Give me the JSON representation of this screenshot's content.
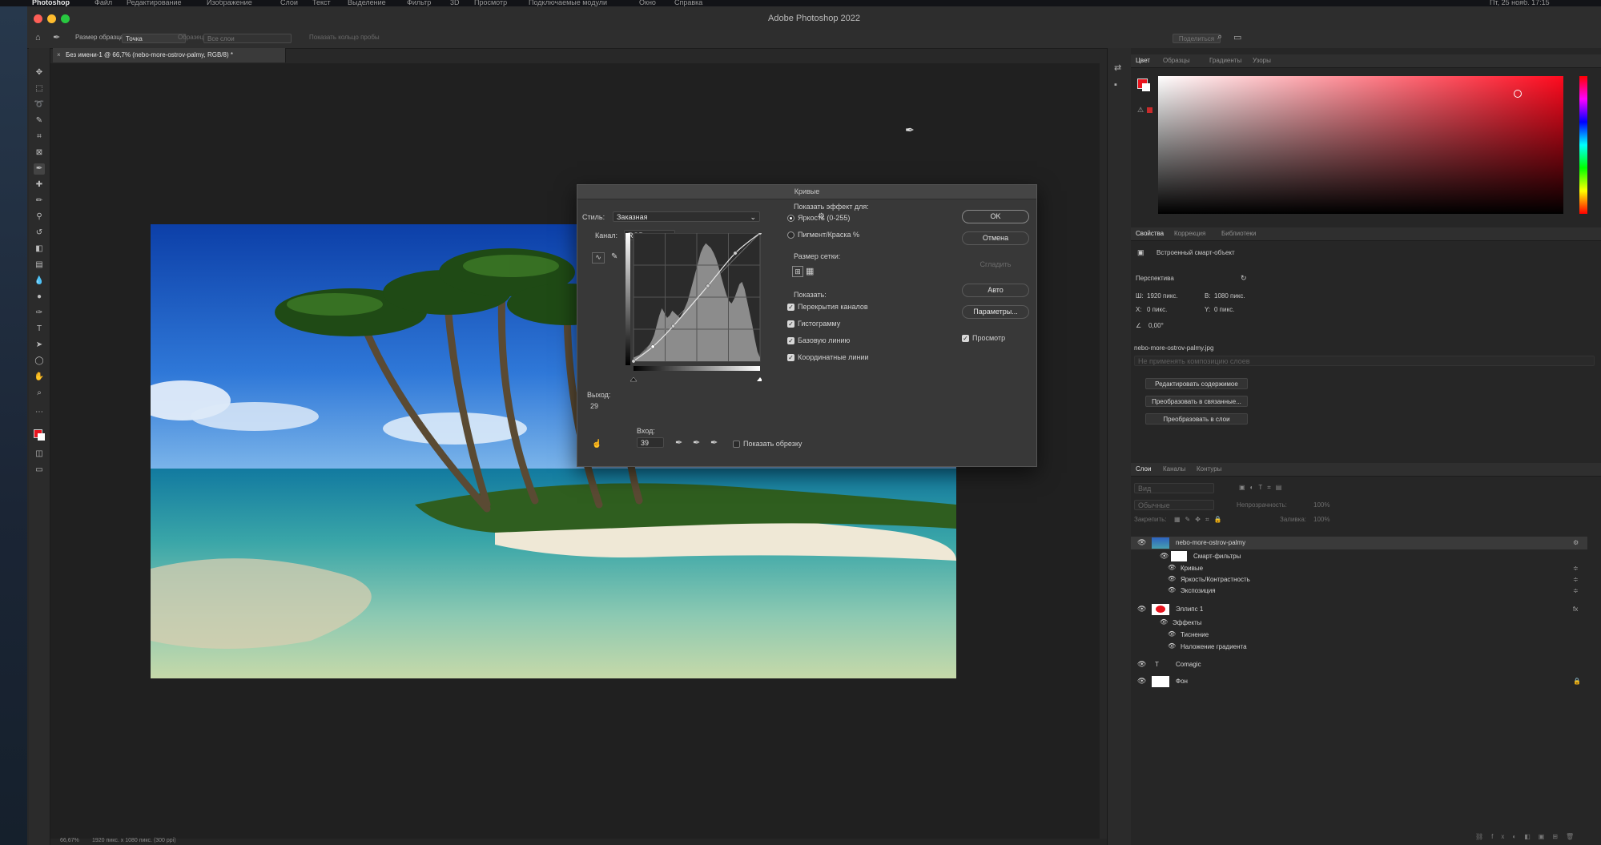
{
  "menu_bar": {
    "items": [
      "Photoshop",
      "Файл",
      "Редактирование",
      "Изображение",
      "Слои",
      "Текст",
      "Выделение",
      "Фильтр",
      "3D",
      "Просмотр",
      "Подключаемые модули",
      "Окно",
      "Справка"
    ],
    "clock": "Пт, 25 нояб. 17:15"
  },
  "window": {
    "title": "Adobe Photoshop 2022"
  },
  "options_bar": {
    "sample_size_label": "Размер образца:",
    "sample_size_value": "Точка",
    "sample_label": "Образец:",
    "sample_value": "Все слои",
    "show_ring": "Показать кольцо пробы",
    "share": "Поделиться"
  },
  "document": {
    "tab_title": "Без имени-1 @ 66,7% (nebo-more-ostrov-palmy, RGB/8) *",
    "zoom": "66,67%",
    "info": "1920 пикс. x 1080 пикс. (300 ppi)"
  },
  "curves_dialog": {
    "title": "Кривые",
    "style_label": "Стиль:",
    "style_value": "Заказная",
    "channel_label": "Канал:",
    "channel_value": "RGB",
    "output_label": "Выход:",
    "output_value": "29",
    "input_label": "Вход:",
    "input_value": "39",
    "show_clipping": "Показать обрезку",
    "show_amount_label": "Показать эффект для:",
    "light_option": "Яркость (0-255)",
    "pigment_option": "Пигмент/Краска %",
    "grid_size_label": "Размер сетки:",
    "show_label": "Показать:",
    "show_options": [
      "Перекрытия каналов",
      "Гистограмму",
      "Базовую линию",
      "Координатные линии"
    ],
    "buttons": {
      "ok": "OK",
      "cancel": "Отмена",
      "smooth": "Сгладить",
      "auto": "Авто",
      "options": "Параметры..."
    },
    "preview": "Просмотр",
    "curve_points": [
      [
        0,
        0
      ],
      [
        39,
        29
      ],
      [
        80,
        70
      ],
      [
        150,
        150
      ],
      [
        205,
        215
      ],
      [
        255,
        255
      ]
    ],
    "histogram": [
      3,
      4,
      5,
      6,
      8,
      10,
      13,
      17,
      22,
      30,
      38,
      44,
      40,
      36,
      38,
      42,
      40,
      38,
      36,
      40,
      45,
      50,
      58,
      66,
      74,
      82,
      90,
      95,
      98,
      96,
      94,
      90,
      85,
      78,
      70,
      62,
      55,
      50,
      48,
      52,
      58,
      64,
      66,
      60,
      50,
      40,
      30,
      18,
      8,
      3
    ]
  },
  "color_panel": {
    "tabs": [
      "Цвет",
      "Образцы",
      "Градиенты",
      "Узоры"
    ],
    "foreground": "#e8141e",
    "background": "#ffffff"
  },
  "properties_panel": {
    "tabs": [
      "Свойства",
      "Коррекция",
      "Библиотеки"
    ],
    "object_type": "Встроенный смарт-объект",
    "section": "Перспектива",
    "w_label": "Ш:",
    "w_value": "1920 пикс.",
    "h_label": "В:",
    "h_value": "1080 пикс.",
    "x_label": "X:",
    "x_value": "0 пикс.",
    "y_label": "Y:",
    "y_value": "0 пикс.",
    "angle_value": "0,00°",
    "file_name": "nebo-more-ostrov-palmy.jpg",
    "comp_placeholder": "Не применять композицию слоев",
    "buttons": [
      "Редактировать содержимое",
      "Преобразовать в связанные...",
      "Преобразовать в слои"
    ]
  },
  "layers_panel": {
    "tabs": [
      "Слои",
      "Каналы",
      "Контуры"
    ],
    "kind_placeholder": "Вид",
    "blend_mode": "Обычные",
    "opacity_label": "Непрозрачность:",
    "opacity_value": "100%",
    "lock_label": "Закрепить:",
    "fill_label": "Заливка:",
    "fill_value": "100%",
    "layers": [
      {
        "name": "nebo-more-ostrov-palmy",
        "kind": "smart"
      },
      {
        "name": "Смарт-фильтры",
        "kind": "sub"
      },
      {
        "name": "Кривые",
        "kind": "filter"
      },
      {
        "name": "Яркость/Контрастность",
        "kind": "filter"
      },
      {
        "name": "Экспозиция",
        "kind": "filter"
      },
      {
        "name": "Эллипс 1",
        "kind": "shape"
      },
      {
        "name": "Эффекты",
        "kind": "sub"
      },
      {
        "name": "Тиснение",
        "kind": "filter"
      },
      {
        "name": "Наложение градиента",
        "kind": "filter"
      },
      {
        "name": "Comagic",
        "kind": "text"
      },
      {
        "name": "Фон",
        "kind": "background"
      }
    ]
  }
}
